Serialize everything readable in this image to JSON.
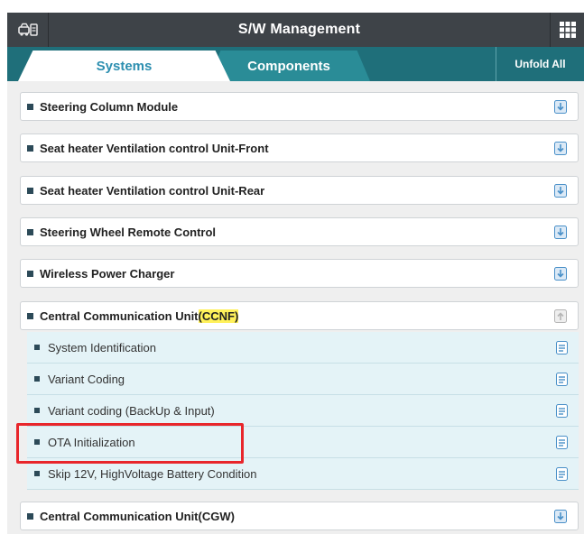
{
  "header": {
    "title": "S/W Management",
    "left_icon": "car-info-icon",
    "right_icon": "grid-menu-icon"
  },
  "tabs": {
    "systems": "Systems",
    "components": "Components",
    "unfold_all": "Unfold All"
  },
  "systems": [
    {
      "label": "Steering Column Module",
      "expanded": false
    },
    {
      "label": "Seat heater Ventilation control Unit-Front",
      "expanded": false
    },
    {
      "label": "Seat heater Ventilation control Unit-Rear",
      "expanded": false
    },
    {
      "label": "Steering Wheel Remote Control",
      "expanded": false
    },
    {
      "label": "Wireless Power Charger",
      "expanded": false
    },
    {
      "label_prefix": "Central Communication Unit",
      "label_highlight": "(CCNF)",
      "expanded": true
    },
    {
      "label": "Central Communication Unit(CGW)",
      "expanded": false
    }
  ],
  "ccnf_items": [
    "System Identification",
    "Variant Coding",
    "Variant coding (BackUp & Input)",
    "OTA Initialization",
    "Skip 12V, HighVoltage Battery Condition"
  ],
  "colors": {
    "title_bar": "#3e4348",
    "tab_bar": "#1f6f7a",
    "active_tab_text": "#2d8fb0",
    "sub_row_bg": "#e4f3f7",
    "highlight": "#fff15a",
    "annotation_box": "#e8262b",
    "icon_blue": "#4a90c8"
  }
}
